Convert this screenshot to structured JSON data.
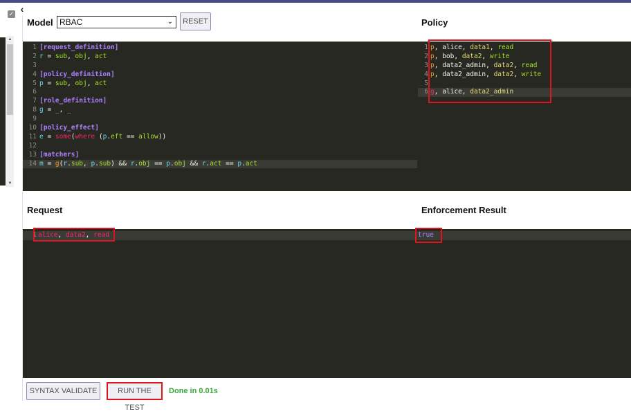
{
  "header": {
    "model_label": "Model",
    "model_select_value": "RBAC",
    "reset_label": "RESET",
    "policy_label": "Policy"
  },
  "model_editor": {
    "lines": [
      {
        "n": "1",
        "tokens": [
          {
            "t": "[request_definition]",
            "c": "sec"
          }
        ]
      },
      {
        "n": "2",
        "tokens": [
          {
            "t": "r",
            "c": "var"
          },
          {
            "t": " = ",
            "c": "op"
          },
          {
            "t": "sub",
            "c": "id"
          },
          {
            "t": ", ",
            "c": "op"
          },
          {
            "t": "obj",
            "c": "id"
          },
          {
            "t": ", ",
            "c": "op"
          },
          {
            "t": "act",
            "c": "id"
          }
        ]
      },
      {
        "n": "3",
        "tokens": []
      },
      {
        "n": "4",
        "tokens": [
          {
            "t": "[policy_definition]",
            "c": "sec"
          }
        ]
      },
      {
        "n": "5",
        "tokens": [
          {
            "t": "p",
            "c": "var"
          },
          {
            "t": " = ",
            "c": "op"
          },
          {
            "t": "sub",
            "c": "id"
          },
          {
            "t": ", ",
            "c": "op"
          },
          {
            "t": "obj",
            "c": "id"
          },
          {
            "t": ", ",
            "c": "op"
          },
          {
            "t": "act",
            "c": "id"
          }
        ]
      },
      {
        "n": "6",
        "tokens": []
      },
      {
        "n": "7",
        "tokens": [
          {
            "t": "[role_definition]",
            "c": "sec"
          }
        ]
      },
      {
        "n": "8",
        "tokens": [
          {
            "t": "g",
            "c": "var"
          },
          {
            "t": " = ",
            "c": "op"
          },
          {
            "t": "_",
            "c": "id"
          },
          {
            "t": ", ",
            "c": "op"
          },
          {
            "t": "_",
            "c": "id"
          }
        ]
      },
      {
        "n": "9",
        "tokens": []
      },
      {
        "n": "10",
        "tokens": [
          {
            "t": "[policy_effect]",
            "c": "sec"
          }
        ]
      },
      {
        "n": "11",
        "tokens": [
          {
            "t": "e",
            "c": "var"
          },
          {
            "t": " = ",
            "c": "op"
          },
          {
            "t": "some",
            "c": "key"
          },
          {
            "t": "(",
            "c": "op"
          },
          {
            "t": "where",
            "c": "key"
          },
          {
            "t": " (",
            "c": "op"
          },
          {
            "t": "p",
            "c": "var"
          },
          {
            "t": ".",
            "c": "op"
          },
          {
            "t": "eft",
            "c": "id"
          },
          {
            "t": " == ",
            "c": "op"
          },
          {
            "t": "allow",
            "c": "id"
          },
          {
            "t": "))",
            "c": "op"
          }
        ]
      },
      {
        "n": "12",
        "tokens": []
      },
      {
        "n": "13",
        "tokens": [
          {
            "t": "[matchers]",
            "c": "sec"
          }
        ]
      },
      {
        "n": "14",
        "active": true,
        "tokens": [
          {
            "t": "m",
            "c": "var"
          },
          {
            "t": " = ",
            "c": "op"
          },
          {
            "t": "g",
            "c": "p"
          },
          {
            "t": "(",
            "c": "op"
          },
          {
            "t": "r",
            "c": "var"
          },
          {
            "t": ".",
            "c": "op"
          },
          {
            "t": "sub",
            "c": "id"
          },
          {
            "t": ", ",
            "c": "op"
          },
          {
            "t": "p",
            "c": "var"
          },
          {
            "t": ".",
            "c": "op"
          },
          {
            "t": "sub",
            "c": "id"
          },
          {
            "t": ") && ",
            "c": "op"
          },
          {
            "t": "r",
            "c": "var"
          },
          {
            "t": ".",
            "c": "op"
          },
          {
            "t": "obj",
            "c": "id"
          },
          {
            "t": " == ",
            "c": "op"
          },
          {
            "t": "p",
            "c": "var"
          },
          {
            "t": ".",
            "c": "op"
          },
          {
            "t": "obj",
            "c": "id"
          },
          {
            "t": " && ",
            "c": "op"
          },
          {
            "t": "r",
            "c": "var"
          },
          {
            "t": ".",
            "c": "op"
          },
          {
            "t": "act",
            "c": "id"
          },
          {
            "t": " == ",
            "c": "op"
          },
          {
            "t": "p",
            "c": "var"
          },
          {
            "t": ".",
            "c": "op"
          },
          {
            "t": "act",
            "c": "id"
          }
        ]
      }
    ]
  },
  "policy_editor": {
    "lines": [
      {
        "n": "1",
        "tokens": [
          {
            "t": "p",
            "c": "p"
          },
          {
            "t": ", ",
            "c": "op"
          },
          {
            "t": "alice",
            "c": "op"
          },
          {
            "t": ", ",
            "c": "op"
          },
          {
            "t": "data1",
            "c": "str"
          },
          {
            "t": ", ",
            "c": "op"
          },
          {
            "t": "read",
            "c": "id"
          }
        ]
      },
      {
        "n": "2",
        "tokens": [
          {
            "t": "p",
            "c": "p"
          },
          {
            "t": ", ",
            "c": "op"
          },
          {
            "t": "bob",
            "c": "op"
          },
          {
            "t": ", ",
            "c": "op"
          },
          {
            "t": "data2",
            "c": "str"
          },
          {
            "t": ", ",
            "c": "op"
          },
          {
            "t": "write",
            "c": "id"
          }
        ]
      },
      {
        "n": "3",
        "tokens": [
          {
            "t": "p",
            "c": "p"
          },
          {
            "t": ", ",
            "c": "op"
          },
          {
            "t": "data2_admin",
            "c": "op"
          },
          {
            "t": ", ",
            "c": "op"
          },
          {
            "t": "data2",
            "c": "str"
          },
          {
            "t": ", ",
            "c": "op"
          },
          {
            "t": "read",
            "c": "id"
          }
        ]
      },
      {
        "n": "4",
        "tokens": [
          {
            "t": "p",
            "c": "p"
          },
          {
            "t": ", ",
            "c": "op"
          },
          {
            "t": "data2_admin",
            "c": "op"
          },
          {
            "t": ", ",
            "c": "op"
          },
          {
            "t": "data2",
            "c": "str"
          },
          {
            "t": ", ",
            "c": "op"
          },
          {
            "t": "write",
            "c": "id"
          }
        ]
      },
      {
        "n": "5",
        "tokens": []
      },
      {
        "n": "6",
        "active": true,
        "tokens": [
          {
            "t": "g",
            "c": "g"
          },
          {
            "t": ", ",
            "c": "op"
          },
          {
            "t": "alice",
            "c": "op"
          },
          {
            "t": ", ",
            "c": "op"
          },
          {
            "t": "data2_admin",
            "c": "str"
          }
        ]
      }
    ]
  },
  "request": {
    "label": "Request",
    "lines": [
      {
        "n": "1",
        "active": true,
        "tokens": [
          {
            "t": "alice",
            "c": "key"
          },
          {
            "t": ", ",
            "c": "op"
          },
          {
            "t": "data2",
            "c": "key"
          },
          {
            "t": ", ",
            "c": "op"
          },
          {
            "t": "read",
            "c": "key"
          }
        ]
      }
    ]
  },
  "result": {
    "label": "Enforcement Result",
    "value": "true"
  },
  "footer": {
    "syntax_validate_label": "SYNTAX VALIDATE",
    "run_test_label": "RUN THE TEST",
    "status_text": "Done in 0.01s"
  },
  "icons": {
    "collapse": "‹",
    "checkbox": "✓",
    "scroll_up": "▲",
    "scroll_down": "▼",
    "select_chevron": "⌄"
  },
  "colors": {
    "editor_bg": "#272822",
    "highlight_box": "#e0141e",
    "status_ok": "#3aa53a",
    "accent_bar": "#4a4a88"
  }
}
